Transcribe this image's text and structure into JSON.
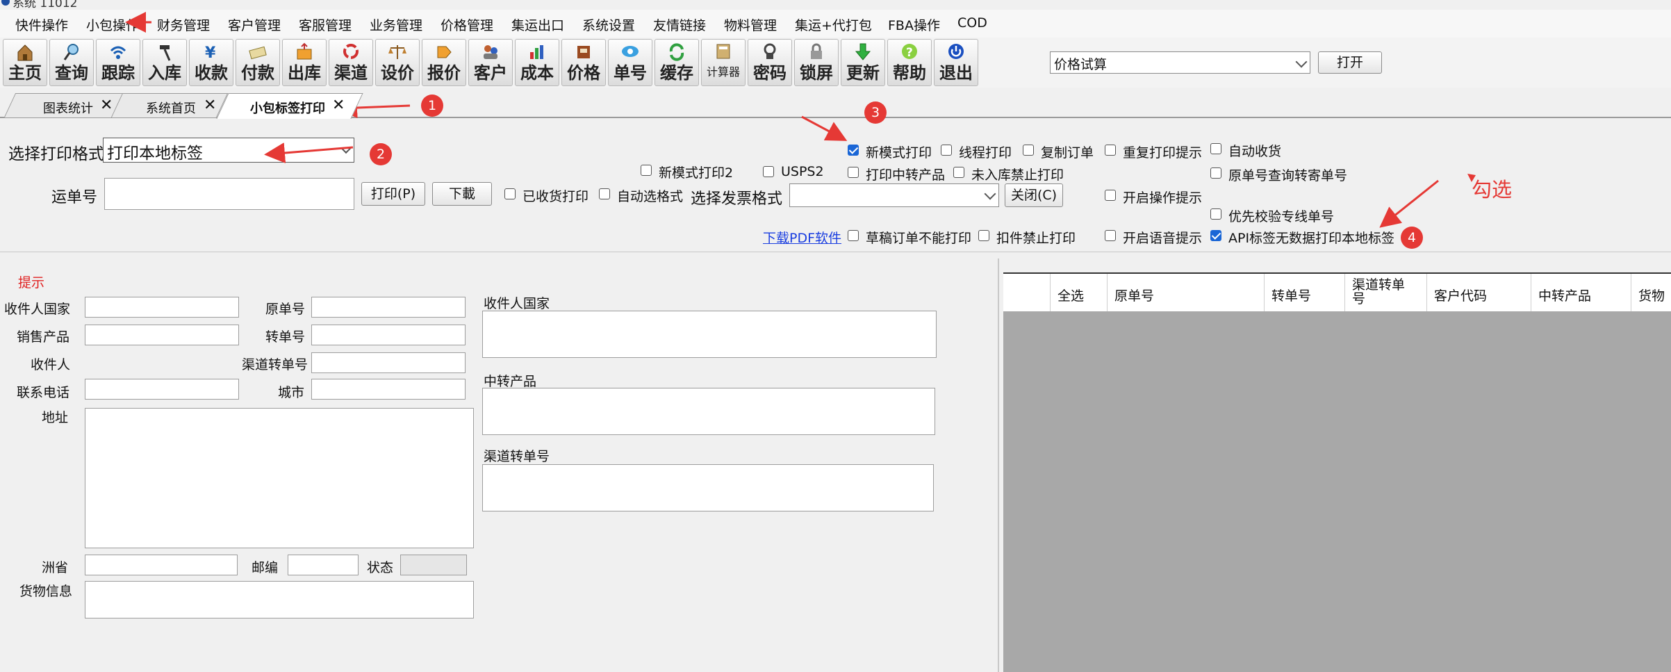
{
  "titlebar": {
    "title": "系统 11012"
  },
  "menu": [
    "快件操作",
    "小包操作",
    "财务管理",
    "客户管理",
    "客服管理",
    "业务管理",
    "价格管理",
    "集运出口",
    "系统设置",
    "友情链接",
    "物料管理",
    "集运+代打包",
    "FBA操作",
    "COD"
  ],
  "toolbar": {
    "buttons": [
      {
        "label": "主页",
        "icon": "home-icon"
      },
      {
        "label": "查询",
        "icon": "magnifier-icon"
      },
      {
        "label": "跟踪",
        "icon": "signal-icon"
      },
      {
        "label": "入库",
        "icon": "hammer-icon"
      },
      {
        "label": "收款",
        "icon": "yen-icon"
      },
      {
        "label": "付款",
        "icon": "money-icon"
      },
      {
        "label": "出库",
        "icon": "box-out-icon"
      },
      {
        "label": "渠道",
        "icon": "cycle-icon"
      },
      {
        "label": "设价",
        "icon": "scale-icon"
      },
      {
        "label": "报价",
        "icon": "price-tag-icon"
      },
      {
        "label": "客户",
        "icon": "users-icon"
      },
      {
        "label": "成本",
        "icon": "bar-chart-icon"
      },
      {
        "label": "价格",
        "icon": "ledger-icon"
      },
      {
        "label": "单号",
        "icon": "eye-icon"
      },
      {
        "label": "缓存",
        "icon": "refresh-icon"
      },
      {
        "label": "计算器",
        "icon": "calculator-icon"
      },
      {
        "label": "密码",
        "icon": "key-icon"
      },
      {
        "label": "锁屏",
        "icon": "lock-icon"
      },
      {
        "label": "更新",
        "icon": "download-arrow-icon"
      },
      {
        "label": "帮助",
        "icon": "help-icon"
      },
      {
        "label": "退出",
        "icon": "power-icon"
      }
    ],
    "quick_select": "价格试算",
    "open_label": "打开"
  },
  "tabs": [
    {
      "label": "图表统计"
    },
    {
      "label": "系统首页"
    },
    {
      "label": "小包标签打印"
    }
  ],
  "form": {
    "print_format_label": "选择打印格式",
    "print_format_value": "打印本地标签",
    "waybill_label": "运单号",
    "print_btn": "打印(P)",
    "download_btn": "下載",
    "invoice_label": "选择发票格式",
    "close_btn": "关闭(C)",
    "pdf_link": "下载PDF软件"
  },
  "checkboxes": {
    "received_print": {
      "label": "已收货打印",
      "checked": false
    },
    "auto_select_format": {
      "label": "自动选格式",
      "checked": false
    },
    "new_mode_print2": {
      "label": "新模式打印2",
      "checked": false
    },
    "usps2": {
      "label": "USPS2",
      "checked": false
    },
    "new_mode_print": {
      "label": "新模式打印",
      "checked": true
    },
    "line_print": {
      "label": "线程打印",
      "checked": false
    },
    "copy_order": {
      "label": "复制订单",
      "checked": false
    },
    "reprint_prompt": {
      "label": "重复打印提示",
      "checked": false
    },
    "auto_receive": {
      "label": "自动收货",
      "checked": false
    },
    "print_transfer_product": {
      "label": "打印中转产品",
      "checked": false
    },
    "no_print_unstocked": {
      "label": "未入库禁止打印",
      "checked": false
    },
    "query_by_original": {
      "label": "原单号查询转寄单号",
      "checked": false
    },
    "operation_prompt": {
      "label": "开启操作提示",
      "checked": false
    },
    "priority_check": {
      "label": "优先校验专线单号",
      "checked": false
    },
    "draft_no_print": {
      "label": "草稿订单不能打印",
      "checked": false
    },
    "hold_no_print": {
      "label": "扣件禁止打印",
      "checked": false
    },
    "voice_prompt": {
      "label": "开启语音提示",
      "checked": false
    },
    "api_local_label": {
      "label": "API标签无数据打印本地标签",
      "checked": true
    }
  },
  "details": {
    "hint": "提示",
    "recipient_country": "收件人国家",
    "original_no": "原单号",
    "sales_product": "销售产品",
    "transfer_no": "转单号",
    "recipient": "收件人",
    "channel_transfer_no": "渠道转单号",
    "phone": "联系电话",
    "city": "城市",
    "address": "地址",
    "state": "洲省",
    "postcode": "邮编",
    "status": "状态",
    "goods_info": "货物信息",
    "right_country": "收件人国家",
    "right_transfer_product": "中转产品",
    "right_channel_no": "渠道转单号"
  },
  "grid": {
    "columns": [
      "",
      "全选",
      "原单号",
      "转单号",
      "渠道转单号",
      "客户代码",
      "中转产品",
      "货物"
    ]
  },
  "annotations": {
    "badges": [
      "1",
      "2",
      "3",
      "4"
    ],
    "note": "勾选"
  },
  "colors": {
    "accent_red": "#e53935",
    "check_blue": "#1a66d6",
    "link_blue": "#1a3ee0",
    "grid_gray": "#a8a8a8"
  }
}
